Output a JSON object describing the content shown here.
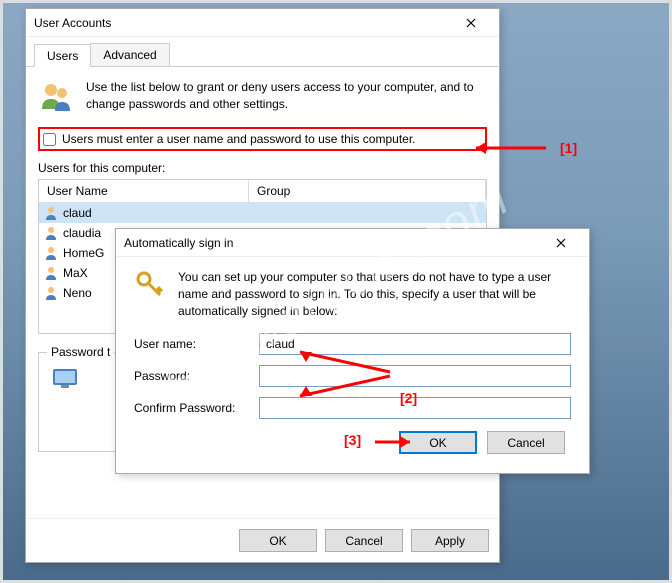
{
  "watermark": "SoftwareOK.com",
  "main": {
    "title": "User Accounts",
    "tabs": [
      "Users",
      "Advanced"
    ],
    "intro": "Use the list below to grant or deny users access to your computer, and to change passwords and other settings.",
    "checkbox_label": "Users must enter a user name and password to use this computer.",
    "users_for_label": "Users for this computer:",
    "columns": {
      "name": "User Name",
      "group": "Group"
    },
    "users": [
      {
        "name": "claud"
      },
      {
        "name": "claudia"
      },
      {
        "name": "HomeG"
      },
      {
        "name": "MaX"
      },
      {
        "name": "Neno"
      }
    ],
    "password_legend": "Password t",
    "buttons": {
      "ok": "OK",
      "cancel": "Cancel",
      "apply": "Apply"
    }
  },
  "dialog": {
    "title": "Automatically sign in",
    "intro": "You can set up your computer so that users do not have to type a user name and password to sign in. To do this, specify a user that will be automatically signed in below:",
    "labels": {
      "user": "User name:",
      "password": "Password:",
      "confirm": "Confirm Password:"
    },
    "values": {
      "user": "claud",
      "password": "",
      "confirm": ""
    },
    "buttons": {
      "ok": "OK",
      "cancel": "Cancel"
    }
  },
  "annotations": {
    "a1": "[1]",
    "a2": "[2]",
    "a3": "[3]"
  }
}
